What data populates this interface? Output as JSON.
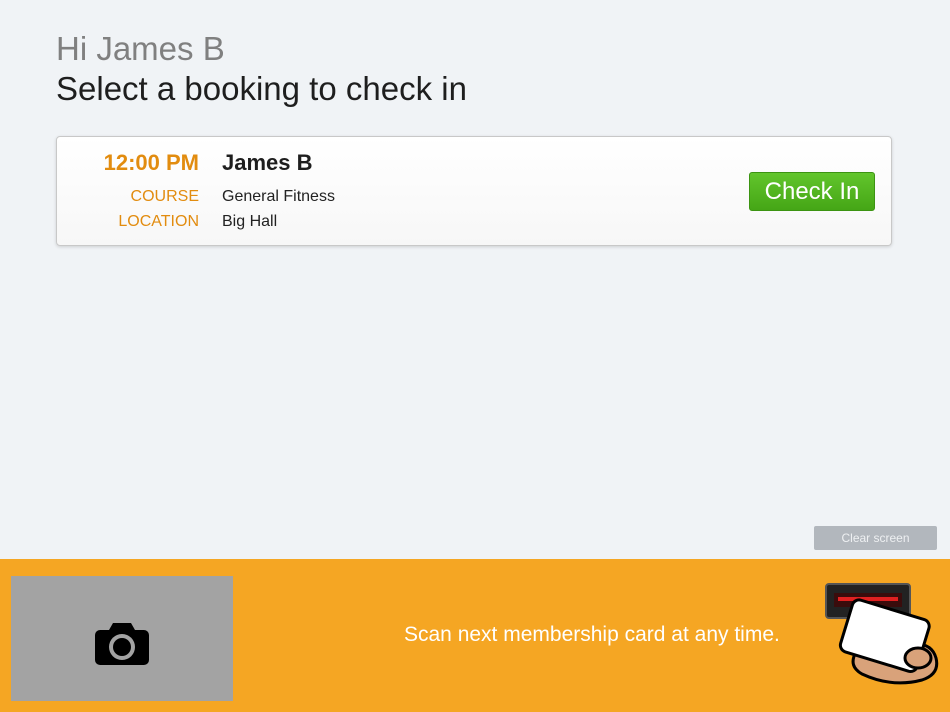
{
  "header": {
    "greeting": "Hi James B",
    "instruction": "Select a booking to check in"
  },
  "booking": {
    "time": "12:00 PM",
    "name": "James B",
    "course_label": "COURSE",
    "course_value": "General Fitness",
    "location_label": "LOCATION",
    "location_value": "Big Hall",
    "check_in_label": "Check In"
  },
  "actions": {
    "clear_label": "Clear screen"
  },
  "footer": {
    "scan_text": "Scan next membership card at any time.",
    "camera_icon": "camera-icon",
    "scanner_icon": "card-scanner-icon"
  },
  "colors": {
    "accent_orange": "#f5a623",
    "label_orange": "#e28c0f",
    "check_in_green": "#4fb11f",
    "background": "#f0f3f6"
  }
}
